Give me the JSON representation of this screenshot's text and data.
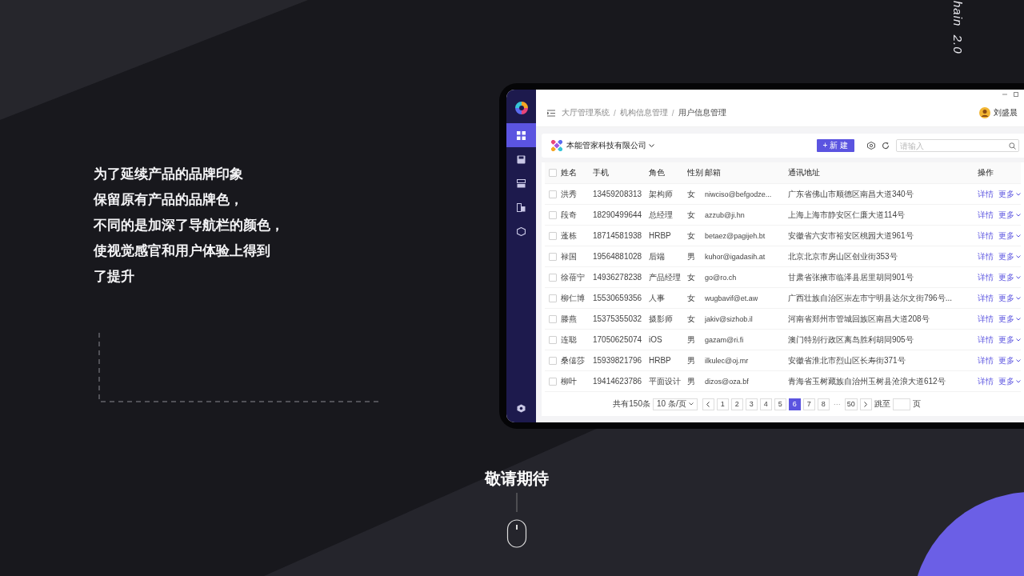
{
  "corner_text": "hain  2.0",
  "intro_lines": [
    "为了延续产品的品牌印象",
    "保留原有产品的品牌色，",
    "不同的是加深了导航栏的颜色，",
    "使视觉感官和用户体验上得到",
    "了提升"
  ],
  "footer_title": "敬请期待",
  "app": {
    "sidebar": {
      "items": [
        {
          "selected": true
        },
        {
          "selected": false
        },
        {
          "selected": false
        },
        {
          "selected": false
        },
        {
          "selected": false
        }
      ]
    },
    "breadcrumb": [
      "大厅管理系统",
      "机构信息管理",
      "用户信息管理"
    ],
    "breadcrumb_separators": [
      "/",
      "/"
    ],
    "user": {
      "name": "刘盛晨"
    },
    "company": "本能管家科技有限公司",
    "new_button": "+ 新 建",
    "search": {
      "placeholder": "请输入"
    },
    "table": {
      "header_checked": false,
      "columns": [
        "姓名",
        "手机",
        "角色",
        "性别",
        "邮箱",
        "通讯地址",
        "操作"
      ],
      "rows": [
        {
          "checked": false,
          "cells": [
            "洪秀",
            "13459208313",
            "架构师",
            "女",
            "niwciso@befgodze...",
            "广东省佛山市顺德区南昌大道340号"
          ],
          "actions": [
            "详情",
            "更多"
          ]
        },
        {
          "checked": false,
          "cells": [
            "段奇",
            "18290499644",
            "总经理",
            "女",
            "azzub@ji.hn",
            "上海上海市静安区仁廉大道114号"
          ],
          "actions": [
            "详情",
            "更多"
          ]
        },
        {
          "checked": false,
          "cells": [
            "蓬栋",
            "18714581938",
            "HRBP",
            "女",
            "betaez@pagijeh.bt",
            "安徽省六安市裕安区桃园大道961号"
          ],
          "actions": [
            "详情",
            "更多"
          ]
        },
        {
          "checked": false,
          "cells": [
            "禄国",
            "19564881028",
            "后端",
            "男",
            "kuhor@igadasih.at",
            "北京北京市房山区创业街353号"
          ],
          "actions": [
            "详情",
            "更多"
          ]
        },
        {
          "checked": false,
          "cells": [
            "徐蓓宁",
            "14936278238",
            "产品经理",
            "女",
            "go@ro.ch",
            "甘肃省张掖市临泽县居里胡同901号"
          ],
          "actions": [
            "详情",
            "更多"
          ]
        },
        {
          "checked": false,
          "cells": [
            "柳仁博",
            "15530659356",
            "人事",
            "女",
            "wugbavif@et.aw",
            "广西壮族自治区崇左市宁明县达尔文街796号..."
          ],
          "actions": [
            "详情",
            "更多"
          ]
        },
        {
          "checked": false,
          "cells": [
            "滕燕",
            "15375355032",
            "摄影师",
            "女",
            "jakiv@sizhob.il",
            "河南省郑州市管城回族区南昌大道208号"
          ],
          "actions": [
            "详情",
            "更多"
          ]
        },
        {
          "checked": false,
          "cells": [
            "连聪",
            "17050625074",
            "iOS",
            "男",
            "gazam@ri.fi",
            "澳门特别行政区离岛胜利胡同905号"
          ],
          "actions": [
            "详情",
            "更多"
          ]
        },
        {
          "checked": false,
          "cells": [
            "桑僖莎",
            "15939821796",
            "HRBP",
            "男",
            "ilkulec@oj.mr",
            "安徽省淮北市烈山区长寿街371号"
          ],
          "actions": [
            "详情",
            "更多"
          ]
        },
        {
          "checked": false,
          "cells": [
            "柳叶",
            "19414623786",
            "平面设计",
            "男",
            "dizos@oza.bf",
            "青海省玉树藏族自治州玉树县沧浪大道612号"
          ],
          "actions": [
            "详情",
            "更多"
          ]
        }
      ]
    },
    "pagination": {
      "total": "共有150条",
      "page_size": "10 条/页",
      "pages": [
        {
          "label": "1",
          "selected": false
        },
        {
          "label": "2",
          "selected": false
        },
        {
          "label": "3",
          "selected": false
        },
        {
          "label": "4",
          "selected": false
        },
        {
          "label": "5",
          "selected": false
        },
        {
          "label": "6",
          "selected": true
        },
        {
          "label": "7",
          "selected": false
        },
        {
          "label": "8",
          "selected": false
        },
        {
          "label": "···",
          "kind": "ellipsis",
          "selected": false
        },
        {
          "label": "50",
          "selected": false
        }
      ],
      "jump_label": "跳至",
      "page_unit": "页"
    }
  }
}
